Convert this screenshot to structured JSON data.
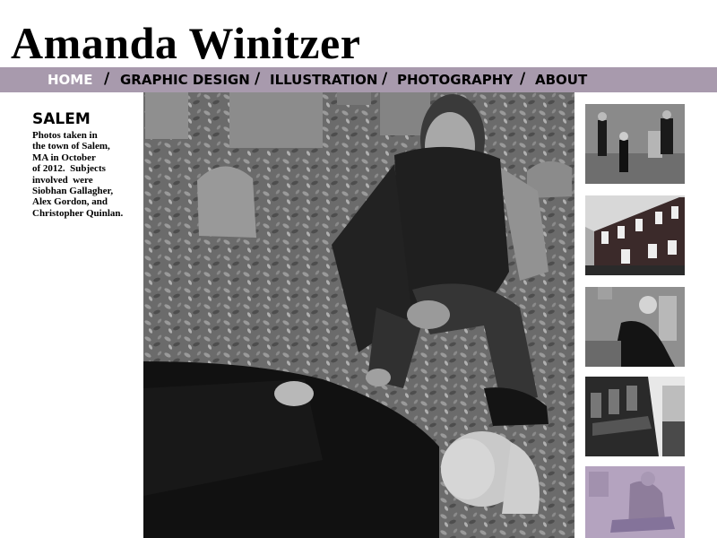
{
  "site": {
    "title": "Amanda Winitzer"
  },
  "nav": {
    "items": [
      {
        "label": "HOME",
        "active": true
      },
      {
        "label": "GRAPHIC DESIGN",
        "active": false
      },
      {
        "label": "ILLUSTRATION",
        "active": false
      },
      {
        "label": "PHOTOGRAPHY",
        "active": false
      },
      {
        "label": "ABOUT",
        "active": false
      }
    ],
    "separator": "/"
  },
  "gallery": {
    "title": "SALEM",
    "description_lines": [
      "Photos taken in",
      "the town of Salem,",
      "MA in October",
      "of 2012.  Subjects",
      "involved  were",
      "Siobhan Gallagher,",
      "Alex Gordon, and",
      "Christopher Quinlan."
    ]
  },
  "colors": {
    "nav_bg": "#a89aad",
    "nav_active": "#ffffff",
    "text": "#000000",
    "thumb_tint": "#b4a3bf"
  }
}
